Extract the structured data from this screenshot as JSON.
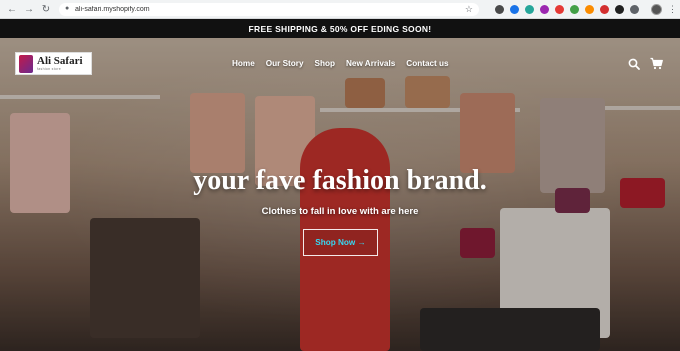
{
  "browser": {
    "url": "ali-safari.myshopify.com",
    "back_icon": "arrow-left-icon",
    "forward_icon": "arrow-right-icon",
    "reload_icon": "reload-icon",
    "extension_colors": [
      "#4a4a4a",
      "#1a73e8",
      "#26a69a",
      "#9c27b0",
      "#e53935",
      "#43a047",
      "#fb8c00",
      "#d32f2f",
      "#212121",
      "#5f6368"
    ]
  },
  "announcement": {
    "text": "FREE SHIPPING & 50% OFF EDING SOON!"
  },
  "header": {
    "logo": {
      "name": "Ali Safari",
      "tagline": "fashion store"
    },
    "nav": [
      "Home",
      "Our Story",
      "Shop",
      "New Arrivals",
      "Contact us"
    ],
    "search_icon": "search-icon",
    "cart_icon": "cart-icon"
  },
  "hero": {
    "headline": "your fave fashion brand.",
    "subheadline": "Clothes to fall in love with are here",
    "cta_label": "Shop Now →",
    "cta_color": "#36d7f2"
  }
}
